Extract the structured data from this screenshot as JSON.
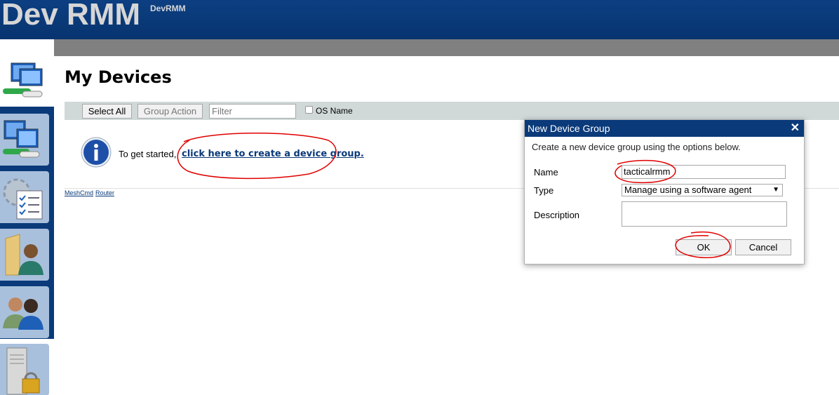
{
  "header": {
    "title": "Dev RMM",
    "subtitle": "DevRMM"
  },
  "page": {
    "title": "My Devices"
  },
  "sidebar": {
    "items": [
      {
        "icon": "devices-icon",
        "label": ""
      },
      {
        "icon": "settings-checklist-icon",
        "label": ""
      },
      {
        "icon": "user-folder-icon",
        "label": ""
      },
      {
        "icon": "users-icon",
        "label": ""
      },
      {
        "icon": "server-lock-icon",
        "label": ""
      }
    ]
  },
  "toolbar": {
    "select_all": "Select All",
    "group_action": "Group Action",
    "filter_placeholder": "Filter",
    "os_name_label": "OS Name"
  },
  "content": {
    "get_started_text": "To get started,",
    "create_group_link": "click here to create a device group."
  },
  "footer": {
    "links": [
      "MeshCmd",
      "Router"
    ]
  },
  "dialog": {
    "title": "New Device Group",
    "close": "✕",
    "description": "Create a new device group using the options below.",
    "name_label": "Name",
    "name_value": "tacticalrmm",
    "type_label": "Type",
    "type_value": "Manage using a software agent",
    "description_label": "Description",
    "ok_label": "OK",
    "cancel_label": "Cancel"
  },
  "colors": {
    "brand": "#0a3a7a",
    "toolbar": "#d0d8d8",
    "annotation": "#e00000"
  }
}
